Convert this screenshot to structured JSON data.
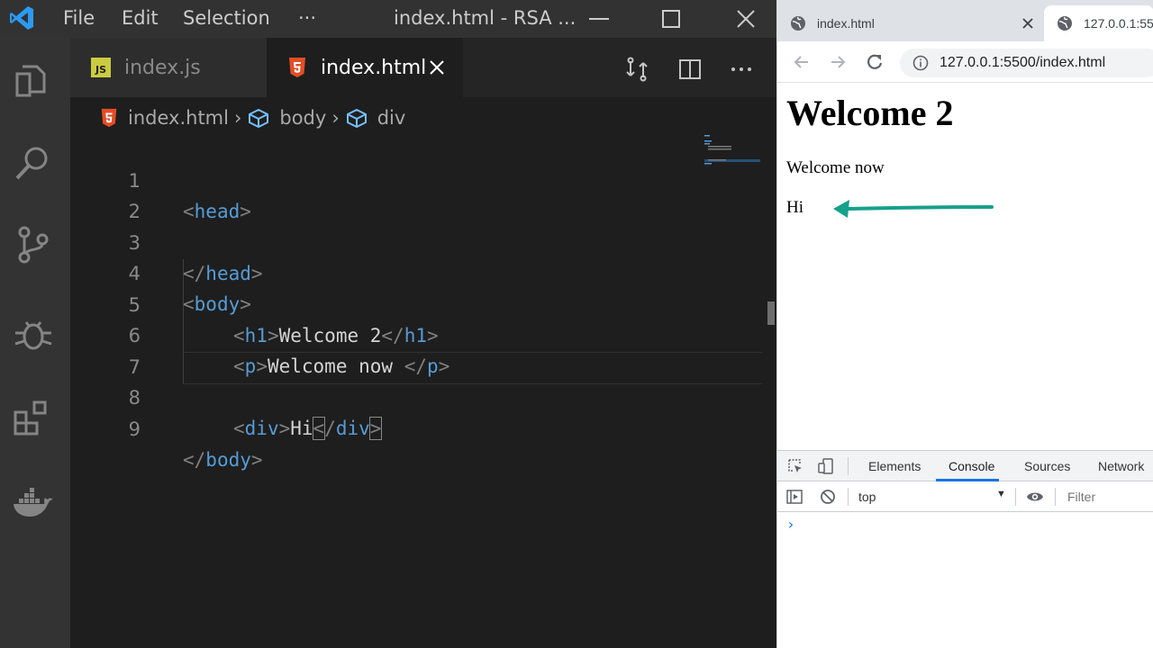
{
  "vscode": {
    "menu": [
      "File",
      "Edit",
      "Selection",
      "···"
    ],
    "window_title": "index.html - RSA ...",
    "tabs": [
      {
        "label": "index.js",
        "icon": "js-file-icon",
        "active": false
      },
      {
        "label": "index.html",
        "icon": "html5-file-icon",
        "active": true
      }
    ],
    "breadcrumb": [
      "index.html",
      "body",
      "div"
    ],
    "code_lines": [
      {
        "num": "1"
      },
      {
        "num": "2"
      },
      {
        "num": "3"
      },
      {
        "num": "4"
      },
      {
        "num": "5"
      },
      {
        "num": "6"
      },
      {
        "num": "7"
      },
      {
        "num": "8"
      },
      {
        "num": "9"
      }
    ],
    "code": {
      "l1_tag": "head",
      "l3_tag": "head",
      "l4_tag": "body",
      "l5_tag": "h1",
      "l5_text": "Welcome 2",
      "l6_tag": "p",
      "l6_text": "Welcome now ",
      "l8_tag": "div",
      "l8_text": "Hi",
      "l9_tag": "body"
    },
    "colors": {
      "keyword_tag": "#569cd6",
      "punctuation": "#808080",
      "text": "#d4d4d4",
      "html_icon": "#e44d26",
      "js_icon": "#cbcb41"
    }
  },
  "browser": {
    "tabs": [
      {
        "label": "index.html"
      },
      {
        "label": "127.0.0.1:55"
      }
    ],
    "url": "127.0.0.1:5500/index.html",
    "page": {
      "h1": "Welcome 2",
      "p": "Welcome now",
      "div": "Hi"
    },
    "annotation_color": "#17a08a",
    "devtools": {
      "tabs": [
        "Elements",
        "Console",
        "Sources",
        "Network"
      ],
      "active_tab": "Console",
      "context": "top",
      "filter_placeholder": "Filter",
      "prompt": "›"
    }
  }
}
